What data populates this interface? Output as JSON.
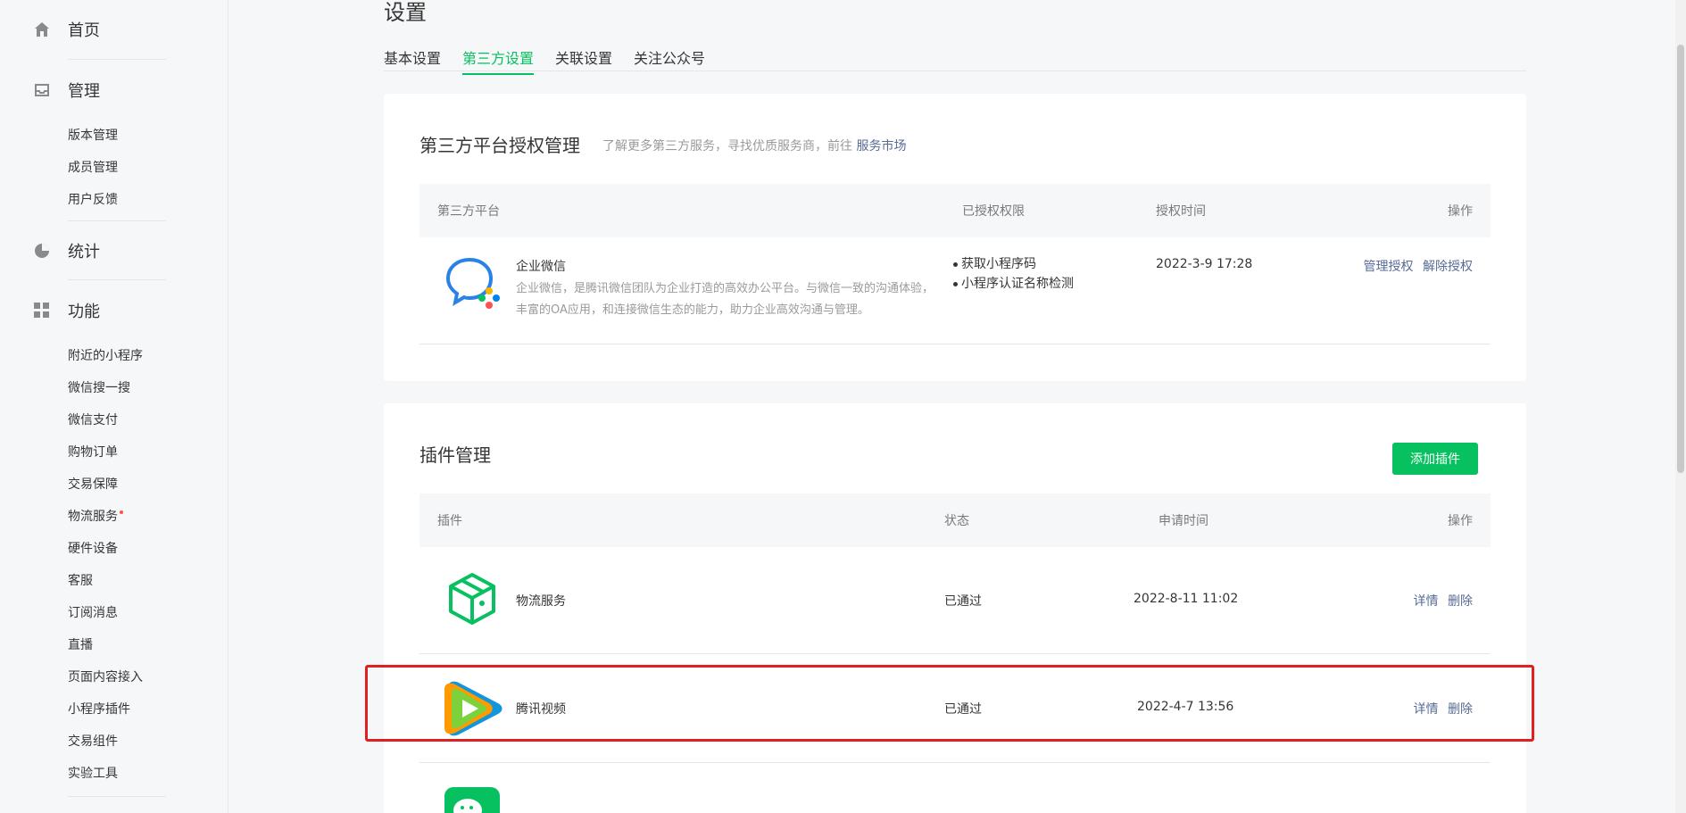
{
  "sidebar": {
    "home_label": "首页",
    "manage_label": "管理",
    "manage_items": [
      "版本管理",
      "成员管理",
      "用户反馈"
    ],
    "stats_label": "统计",
    "features_label": "功能",
    "feature_items": [
      "附近的小程序",
      "微信搜一搜",
      "微信支付",
      "购物订单",
      "交易保障",
      "物流服务",
      "硬件设备",
      "客服",
      "订阅消息",
      "直播",
      "页面内容接入",
      "小程序插件",
      "交易组件",
      "实验工具"
    ]
  },
  "header": {
    "title": "设置",
    "tabs": [
      "基本设置",
      "第三方设置",
      "关联设置",
      "关注公众号"
    ],
    "active_tab": "第三方设置"
  },
  "third_party": {
    "title": "第三方平台授权管理",
    "tip_prefix": "了解更多第三方服务，寻找优质服务商，前往",
    "tip_link": "服务市场",
    "columns": [
      "第三方平台",
      "已授权权限",
      "授权时间",
      "操作"
    ],
    "rows": [
      {
        "name": "企业微信",
        "desc": "企业微信，是腾讯微信团队为企业打造的高效办公平台。与微信一致的沟通体验，丰富的OA应用，和连接微信生态的能力，助力企业高效沟通与管理。",
        "permissions": [
          "获取小程序码",
          "小程序认证名称检测"
        ],
        "time": "2022-3-9 17:28",
        "actions": [
          "管理授权",
          "解除授权"
        ],
        "icon": "wecom-logo-icon"
      }
    ]
  },
  "plugins": {
    "title": "插件管理",
    "add_label": "添加插件",
    "columns": [
      "插件",
      "状态",
      "申请时间",
      "操作"
    ],
    "rows": [
      {
        "name": "物流服务",
        "status": "已通过",
        "time": "2022-8-11 11:02",
        "actions": [
          "详情",
          "删除"
        ],
        "icon": "logistics-box-icon"
      },
      {
        "name": "腾讯视频",
        "status": "已通过",
        "time": "2022-4-7 13:56",
        "actions": [
          "详情",
          "删除"
        ],
        "icon": "tencent-video-icon"
      }
    ]
  },
  "colors": {
    "accent": "#07c160",
    "link": "#576b95",
    "highlight": "#e02020"
  }
}
